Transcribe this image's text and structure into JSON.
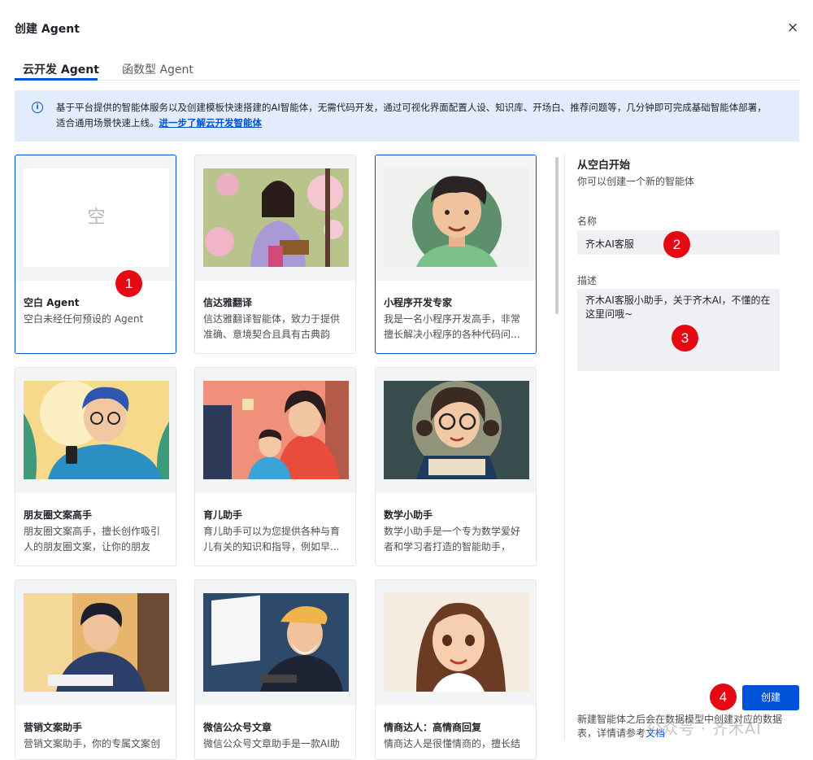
{
  "dialog": {
    "title": "创建 Agent",
    "close": "×"
  },
  "tabs": [
    {
      "label": "云开发 Agent"
    },
    {
      "label": "函数型 Agent"
    }
  ],
  "info": {
    "icon": "i",
    "text": "基于平台提供的智能体服务以及创建模板快速搭建的AI智能体，无需代码开发，通过可视化界面配置人设、知识库、开场白、推荐问题等，几分钟即可完成基础智能体部署，适合通用场景快速上线。",
    "link": "进一步了解云开发智能体"
  },
  "cards": [
    {
      "title": "空白 Agent",
      "desc": "空白未经任何预设的 Agent",
      "placeholder": "空"
    },
    {
      "title": "信达雅翻译",
      "desc": "信达雅翻译智能体，致力于提供准确、意境契合且具有古典韵味..."
    },
    {
      "title": "小程序开发专家",
      "desc": "我是一名小程序开发高手，非常擅长解决小程序的各种代码问..."
    },
    {
      "title": "朋友圈文案高手",
      "desc": "朋友圈文案高手，擅长创作吸引人的朋友圈文案，让你的朋友圈..."
    },
    {
      "title": "育儿助手",
      "desc": "育儿助手可以为您提供各种与育儿有关的知识和指导，例如早..."
    },
    {
      "title": "数学小助手",
      "desc": "数学小助手是一个专为数学爱好者和学习者打造的智能助手，无..."
    },
    {
      "title": "营销文案助手",
      "desc": "营销文案助手，你的专属文案创"
    },
    {
      "title": "微信公众号文章",
      "desc": "微信公众号文章助手是一款AI助"
    },
    {
      "title": "情商达人：高情商回复",
      "desc": "情商达人是很懂情商的，擅长结"
    }
  ],
  "panel": {
    "title": "从空白开始",
    "subtitle": "你可以创建一个新的智能体",
    "name_label": "名称",
    "name_value": "齐木AI客服",
    "desc_label": "描述",
    "desc_value": "齐木AI客服小助手，关于齐木AI，不懂的在这里问哦~",
    "create_button": "创建",
    "footer_text": "新建智能体之后会在数据模型中创建对应的数据表，详情请参考",
    "footer_link": "文档"
  },
  "badges": [
    "1",
    "2",
    "3",
    "4"
  ],
  "watermark": "公众号 · 齐木AI",
  "colors": {
    "primary": "#0052d9",
    "info_bg": "#e3ecfc",
    "badge": "#e50914"
  }
}
